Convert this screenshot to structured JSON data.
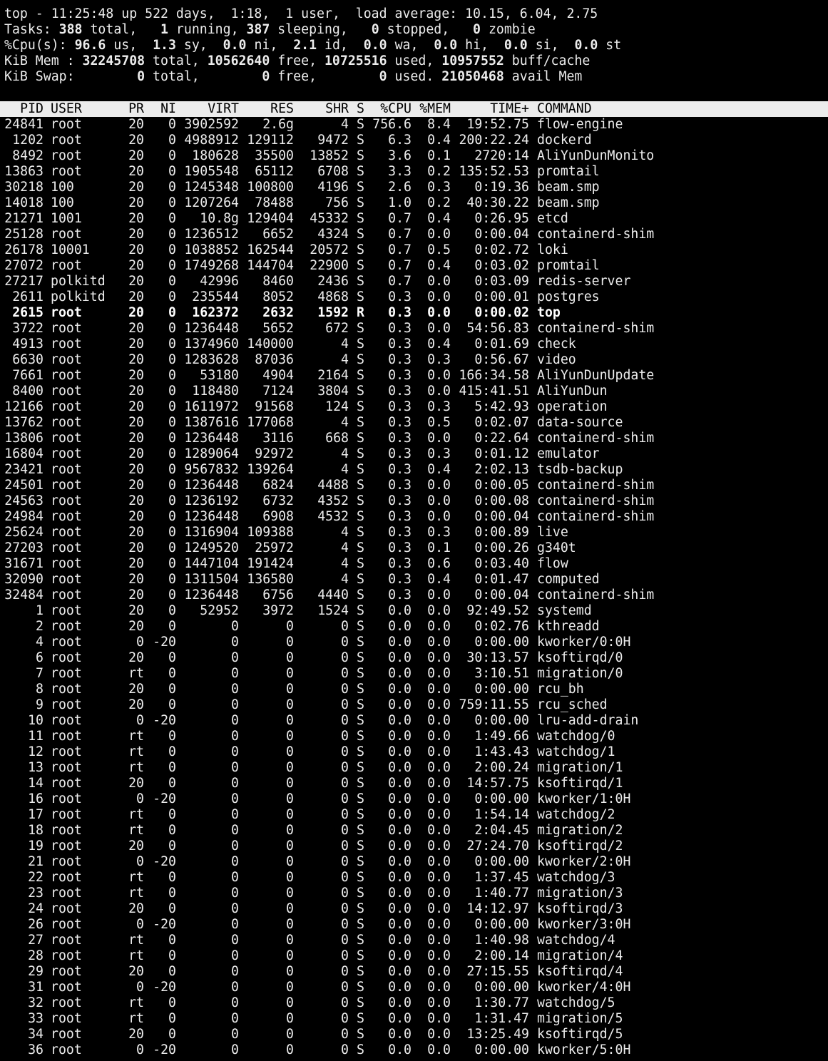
{
  "summary": {
    "l1": {
      "prefix": "top - ",
      "time": "11:25:48",
      "mid1": " up ",
      "uptime": "522 days,  1:18",
      "mid2": ",  ",
      "users": "1 user",
      "mid3": ",  load average: ",
      "load": "10.15, 6.04, 2.75"
    },
    "l2": {
      "label": "Tasks: ",
      "total": "388",
      "t1": " total,   ",
      "running": "1",
      "t2": " running, ",
      "sleeping": "387",
      "t3": " sleeping,   ",
      "stopped": "0",
      "t4": " stopped,   ",
      "zombie": "0",
      "t5": " zombie"
    },
    "l3": {
      "label": "%Cpu(s): ",
      "us": "96.6",
      "s1": " us,  ",
      "sy": "1.3",
      "s2": " sy,  ",
      "ni": "0.0",
      "s3": " ni,  ",
      "id": "2.1",
      "s4": " id,  ",
      "wa": "0.0",
      "s5": " wa,  ",
      "hi": "0.0",
      "s6": " hi,  ",
      "si": "0.0",
      "s7": " si,  ",
      "st": "0.0",
      "s8": " st"
    },
    "l4": {
      "label": "KiB Mem : ",
      "total": "32245708",
      "m1": " total, ",
      "free": "10562640",
      "m2": " free, ",
      "used": "10725516",
      "m3": " used, ",
      "buff": "10957552",
      "m4": " buff/cache"
    },
    "l5": {
      "label": "KiB Swap:        ",
      "total": "0",
      "w1": " total,        ",
      "free": "0",
      "w2": " free,        ",
      "used": "0",
      "w3": " used. ",
      "avail": "21050468",
      "w4": " avail Mem"
    }
  },
  "columns": [
    "PID",
    "USER",
    "PR",
    "NI",
    "VIRT",
    "RES",
    "SHR",
    "S",
    "%CPU",
    "%MEM",
    "TIME+",
    "COMMAND"
  ],
  "processes": [
    [
      "24841",
      "root",
      "20",
      "0",
      "3902592",
      "2.6g",
      "4",
      "S",
      "756.6",
      "8.4",
      "19:52.75",
      "flow-engine"
    ],
    [
      "1202",
      "root",
      "20",
      "0",
      "4988912",
      "129112",
      "9472",
      "S",
      "6.3",
      "0.4",
      "200:22.24",
      "dockerd"
    ],
    [
      "8492",
      "root",
      "20",
      "0",
      "180628",
      "35500",
      "13852",
      "S",
      "3.6",
      "0.1",
      "2720:14",
      "AliYunDunMonito"
    ],
    [
      "13863",
      "root",
      "20",
      "0",
      "1905548",
      "65112",
      "6708",
      "S",
      "3.3",
      "0.2",
      "135:52.53",
      "promtail"
    ],
    [
      "30218",
      "100",
      "20",
      "0",
      "1245348",
      "100800",
      "4196",
      "S",
      "2.6",
      "0.3",
      "0:19.36",
      "beam.smp"
    ],
    [
      "14018",
      "100",
      "20",
      "0",
      "1207264",
      "78488",
      "756",
      "S",
      "1.0",
      "0.2",
      "40:30.22",
      "beam.smp"
    ],
    [
      "21271",
      "1001",
      "20",
      "0",
      "10.8g",
      "129404",
      "45332",
      "S",
      "0.7",
      "0.4",
      "0:26.95",
      "etcd"
    ],
    [
      "25128",
      "root",
      "20",
      "0",
      "1236512",
      "6652",
      "4324",
      "S",
      "0.7",
      "0.0",
      "0:00.04",
      "containerd-shim"
    ],
    [
      "26178",
      "10001",
      "20",
      "0",
      "1038852",
      "162544",
      "20572",
      "S",
      "0.7",
      "0.5",
      "0:02.72",
      "loki"
    ],
    [
      "27072",
      "root",
      "20",
      "0",
      "1749268",
      "144704",
      "22900",
      "S",
      "0.7",
      "0.4",
      "0:03.02",
      "promtail"
    ],
    [
      "27217",
      "polkitd",
      "20",
      "0",
      "42996",
      "8460",
      "2436",
      "S",
      "0.7",
      "0.0",
      "0:03.09",
      "redis-server"
    ],
    [
      "2611",
      "polkitd",
      "20",
      "0",
      "235544",
      "8052",
      "4868",
      "S",
      "0.3",
      "0.0",
      "0:00.01",
      "postgres"
    ],
    [
      "2615",
      "root",
      "20",
      "0",
      "162372",
      "2632",
      "1592",
      "R",
      "0.3",
      "0.0",
      "0:00.02",
      "top"
    ],
    [
      "3722",
      "root",
      "20",
      "0",
      "1236448",
      "5652",
      "672",
      "S",
      "0.3",
      "0.0",
      "54:56.83",
      "containerd-shim"
    ],
    [
      "4913",
      "root",
      "20",
      "0",
      "1374960",
      "140000",
      "4",
      "S",
      "0.3",
      "0.4",
      "0:01.69",
      "check"
    ],
    [
      "6630",
      "root",
      "20",
      "0",
      "1283628",
      "87036",
      "4",
      "S",
      "0.3",
      "0.3",
      "0:56.67",
      "video"
    ],
    [
      "7661",
      "root",
      "20",
      "0",
      "53180",
      "4904",
      "2164",
      "S",
      "0.3",
      "0.0",
      "166:34.58",
      "AliYunDunUpdate"
    ],
    [
      "8400",
      "root",
      "20",
      "0",
      "118480",
      "7124",
      "3804",
      "S",
      "0.3",
      "0.0",
      "415:41.51",
      "AliYunDun"
    ],
    [
      "12166",
      "root",
      "20",
      "0",
      "1611972",
      "91568",
      "124",
      "S",
      "0.3",
      "0.3",
      "5:42.93",
      "operation"
    ],
    [
      "13762",
      "root",
      "20",
      "0",
      "1387616",
      "177068",
      "4",
      "S",
      "0.3",
      "0.5",
      "0:02.07",
      "data-source"
    ],
    [
      "13806",
      "root",
      "20",
      "0",
      "1236448",
      "3116",
      "668",
      "S",
      "0.3",
      "0.0",
      "0:22.64",
      "containerd-shim"
    ],
    [
      "16804",
      "root",
      "20",
      "0",
      "1289064",
      "92972",
      "4",
      "S",
      "0.3",
      "0.3",
      "0:01.12",
      "emulator"
    ],
    [
      "23421",
      "root",
      "20",
      "0",
      "9567832",
      "139264",
      "4",
      "S",
      "0.3",
      "0.4",
      "2:02.13",
      "tsdb-backup"
    ],
    [
      "24501",
      "root",
      "20",
      "0",
      "1236448",
      "6824",
      "4488",
      "S",
      "0.3",
      "0.0",
      "0:00.05",
      "containerd-shim"
    ],
    [
      "24563",
      "root",
      "20",
      "0",
      "1236192",
      "6732",
      "4352",
      "S",
      "0.3",
      "0.0",
      "0:00.08",
      "containerd-shim"
    ],
    [
      "24984",
      "root",
      "20",
      "0",
      "1236448",
      "6908",
      "4532",
      "S",
      "0.3",
      "0.0",
      "0:00.04",
      "containerd-shim"
    ],
    [
      "25624",
      "root",
      "20",
      "0",
      "1316904",
      "109388",
      "4",
      "S",
      "0.3",
      "0.3",
      "0:00.89",
      "live"
    ],
    [
      "27203",
      "root",
      "20",
      "0",
      "1249520",
      "25972",
      "4",
      "S",
      "0.3",
      "0.1",
      "0:00.26",
      "g340t"
    ],
    [
      "31671",
      "root",
      "20",
      "0",
      "1447104",
      "191424",
      "4",
      "S",
      "0.3",
      "0.6",
      "0:03.40",
      "flow"
    ],
    [
      "32090",
      "root",
      "20",
      "0",
      "1311504",
      "136580",
      "4",
      "S",
      "0.3",
      "0.4",
      "0:01.47",
      "computed"
    ],
    [
      "32484",
      "root",
      "20",
      "0",
      "1236448",
      "6756",
      "4440",
      "S",
      "0.3",
      "0.0",
      "0:00.04",
      "containerd-shim"
    ],
    [
      "1",
      "root",
      "20",
      "0",
      "52952",
      "3972",
      "1524",
      "S",
      "0.0",
      "0.0",
      "92:49.52",
      "systemd"
    ],
    [
      "2",
      "root",
      "20",
      "0",
      "0",
      "0",
      "0",
      "S",
      "0.0",
      "0.0",
      "0:02.76",
      "kthreadd"
    ],
    [
      "4",
      "root",
      "0",
      "-20",
      "0",
      "0",
      "0",
      "S",
      "0.0",
      "0.0",
      "0:00.00",
      "kworker/0:0H"
    ],
    [
      "6",
      "root",
      "20",
      "0",
      "0",
      "0",
      "0",
      "S",
      "0.0",
      "0.0",
      "30:13.57",
      "ksoftirqd/0"
    ],
    [
      "7",
      "root",
      "rt",
      "0",
      "0",
      "0",
      "0",
      "S",
      "0.0",
      "0.0",
      "3:10.51",
      "migration/0"
    ],
    [
      "8",
      "root",
      "20",
      "0",
      "0",
      "0",
      "0",
      "S",
      "0.0",
      "0.0",
      "0:00.00",
      "rcu_bh"
    ],
    [
      "9",
      "root",
      "20",
      "0",
      "0",
      "0",
      "0",
      "S",
      "0.0",
      "0.0",
      "759:11.55",
      "rcu_sched"
    ],
    [
      "10",
      "root",
      "0",
      "-20",
      "0",
      "0",
      "0",
      "S",
      "0.0",
      "0.0",
      "0:00.00",
      "lru-add-drain"
    ],
    [
      "11",
      "root",
      "rt",
      "0",
      "0",
      "0",
      "0",
      "S",
      "0.0",
      "0.0",
      "1:49.66",
      "watchdog/0"
    ],
    [
      "12",
      "root",
      "rt",
      "0",
      "0",
      "0",
      "0",
      "S",
      "0.0",
      "0.0",
      "1:43.43",
      "watchdog/1"
    ],
    [
      "13",
      "root",
      "rt",
      "0",
      "0",
      "0",
      "0",
      "S",
      "0.0",
      "0.0",
      "2:00.24",
      "migration/1"
    ],
    [
      "14",
      "root",
      "20",
      "0",
      "0",
      "0",
      "0",
      "S",
      "0.0",
      "0.0",
      "14:57.75",
      "ksoftirqd/1"
    ],
    [
      "16",
      "root",
      "0",
      "-20",
      "0",
      "0",
      "0",
      "S",
      "0.0",
      "0.0",
      "0:00.00",
      "kworker/1:0H"
    ],
    [
      "17",
      "root",
      "rt",
      "0",
      "0",
      "0",
      "0",
      "S",
      "0.0",
      "0.0",
      "1:54.14",
      "watchdog/2"
    ],
    [
      "18",
      "root",
      "rt",
      "0",
      "0",
      "0",
      "0",
      "S",
      "0.0",
      "0.0",
      "2:04.45",
      "migration/2"
    ],
    [
      "19",
      "root",
      "20",
      "0",
      "0",
      "0",
      "0",
      "S",
      "0.0",
      "0.0",
      "27:24.70",
      "ksoftirqd/2"
    ],
    [
      "21",
      "root",
      "0",
      "-20",
      "0",
      "0",
      "0",
      "S",
      "0.0",
      "0.0",
      "0:00.00",
      "kworker/2:0H"
    ],
    [
      "22",
      "root",
      "rt",
      "0",
      "0",
      "0",
      "0",
      "S",
      "0.0",
      "0.0",
      "1:37.45",
      "watchdog/3"
    ],
    [
      "23",
      "root",
      "rt",
      "0",
      "0",
      "0",
      "0",
      "S",
      "0.0",
      "0.0",
      "1:40.77",
      "migration/3"
    ],
    [
      "24",
      "root",
      "20",
      "0",
      "0",
      "0",
      "0",
      "S",
      "0.0",
      "0.0",
      "14:12.97",
      "ksoftirqd/3"
    ],
    [
      "26",
      "root",
      "0",
      "-20",
      "0",
      "0",
      "0",
      "S",
      "0.0",
      "0.0",
      "0:00.00",
      "kworker/3:0H"
    ],
    [
      "27",
      "root",
      "rt",
      "0",
      "0",
      "0",
      "0",
      "S",
      "0.0",
      "0.0",
      "1:40.98",
      "watchdog/4"
    ],
    [
      "28",
      "root",
      "rt",
      "0",
      "0",
      "0",
      "0",
      "S",
      "0.0",
      "0.0",
      "2:00.14",
      "migration/4"
    ],
    [
      "29",
      "root",
      "20",
      "0",
      "0",
      "0",
      "0",
      "S",
      "0.0",
      "0.0",
      "27:15.55",
      "ksoftirqd/4"
    ],
    [
      "31",
      "root",
      "0",
      "-20",
      "0",
      "0",
      "0",
      "S",
      "0.0",
      "0.0",
      "0:00.00",
      "kworker/4:0H"
    ],
    [
      "32",
      "root",
      "rt",
      "0",
      "0",
      "0",
      "0",
      "S",
      "0.0",
      "0.0",
      "1:30.77",
      "watchdog/5"
    ],
    [
      "33",
      "root",
      "rt",
      "0",
      "0",
      "0",
      "0",
      "S",
      "0.0",
      "0.0",
      "1:31.47",
      "migration/5"
    ],
    [
      "34",
      "root",
      "20",
      "0",
      "0",
      "0",
      "0",
      "S",
      "0.0",
      "0.0",
      "13:25.49",
      "ksoftirqd/5"
    ],
    [
      "36",
      "root",
      "0",
      "-20",
      "0",
      "0",
      "0",
      "S",
      "0.0",
      "0.0",
      "0:00.00",
      "kworker/5:0H"
    ]
  ]
}
